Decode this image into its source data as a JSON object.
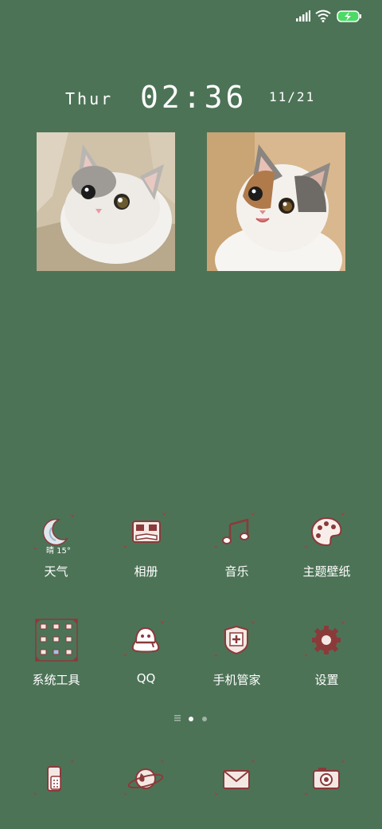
{
  "status_bar": {
    "icons": [
      "signal-icon",
      "wifi-icon",
      "battery-charging-icon"
    ],
    "battery_color": "#4cd964"
  },
  "clock": {
    "day": "Thur",
    "time": "02:36",
    "date": "11/21"
  },
  "photos": [
    {
      "name": "cat-photo-left",
      "subject": "white cat in box"
    },
    {
      "name": "cat-photo-right",
      "subject": "calico cat"
    }
  ],
  "weather": {
    "temp": "晴 15°"
  },
  "apps_row1": [
    {
      "label": "天气",
      "icon": "moon-weather-icon"
    },
    {
      "label": "相册",
      "icon": "album-icon"
    },
    {
      "label": "音乐",
      "icon": "music-note-icon"
    },
    {
      "label": "主题壁纸",
      "icon": "palette-icon"
    }
  ],
  "apps_row2": [
    {
      "label": "系统工具",
      "icon": "tools-folder-icon"
    },
    {
      "label": "QQ",
      "icon": "penguin-icon"
    },
    {
      "label": "手机管家",
      "icon": "shield-icon"
    },
    {
      "label": "设置",
      "icon": "gear-icon"
    }
  ],
  "dock": [
    {
      "icon": "phone-icon"
    },
    {
      "icon": "browser-planet-icon"
    },
    {
      "icon": "message-envelope-icon"
    },
    {
      "icon": "camera-icon"
    }
  ],
  "page_indicator": {
    "pages": 3,
    "current": 2
  },
  "colors": {
    "background": "#4d7357",
    "icon_outline": "#8b3a3a",
    "heart": "#a83a3a",
    "text": "#ffffff"
  }
}
